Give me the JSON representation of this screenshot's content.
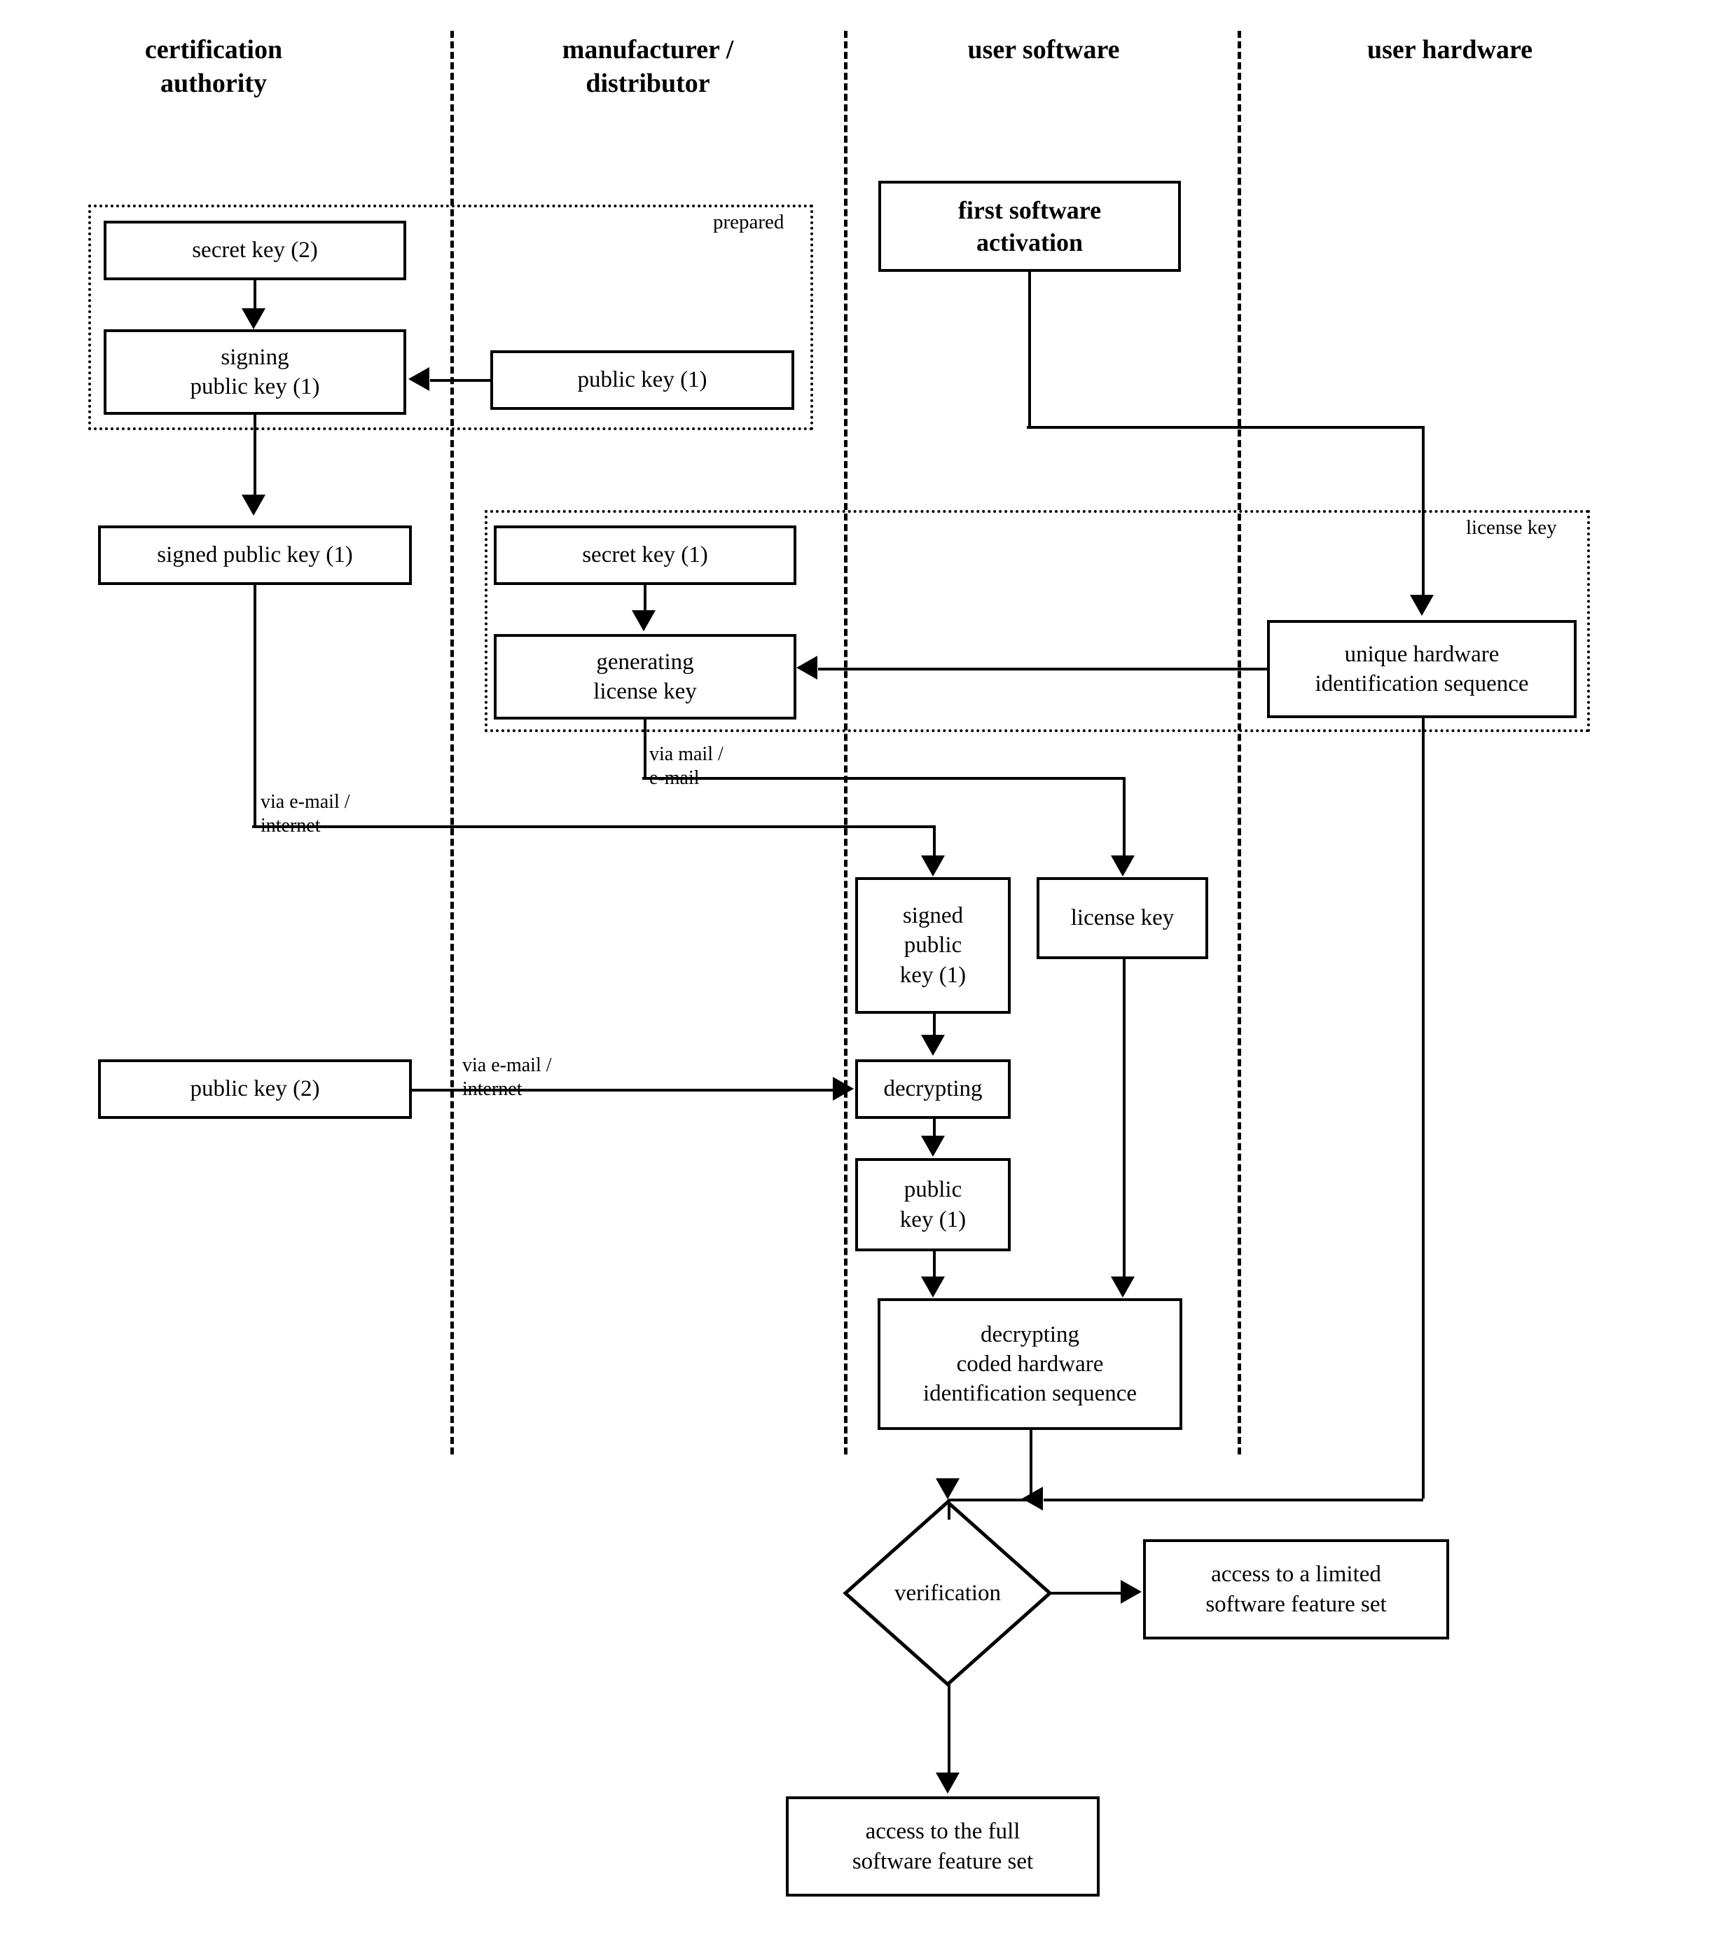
{
  "diagram": {
    "title": "software licensing and activation flowchart",
    "lanes": [
      {
        "label": "certification\nauthority"
      },
      {
        "label": "manufacturer /\ndistributor"
      },
      {
        "label": "user software"
      },
      {
        "label": "user hardware"
      }
    ],
    "groups": [
      {
        "label": "prepared"
      },
      {
        "label": "license key"
      }
    ],
    "nodes": [
      {
        "id": "secret-key-2",
        "label": "secret key (2)"
      },
      {
        "id": "signing-public-key-1",
        "label": "signing\npublic key (1)"
      },
      {
        "id": "public-key-1-mfr",
        "label": "public key (1)"
      },
      {
        "id": "first-software-activation",
        "label": "first software\nactivation"
      },
      {
        "id": "signed-public-key-1-ca",
        "label": "signed public key (1)"
      },
      {
        "id": "secret-key-1",
        "label": "secret key (1)"
      },
      {
        "id": "generating-license-key",
        "label": "generating\nlicense key"
      },
      {
        "id": "unique-hardware-id-sequence",
        "label": "unique hardware\nidentification sequence"
      },
      {
        "id": "signed-public-key-1-user",
        "label": "signed\npublic\nkey (1)"
      },
      {
        "id": "license-key",
        "label": "license key"
      },
      {
        "id": "public-key-2",
        "label": "public key (2)"
      },
      {
        "id": "decrypting",
        "label": "decrypting"
      },
      {
        "id": "public-key-1-user",
        "label": "public\nkey (1)"
      },
      {
        "id": "decrypting-coded-hardware",
        "label": "decrypting\ncoded hardware\nidentification sequence"
      },
      {
        "id": "verification",
        "label": "verification"
      },
      {
        "id": "access-limited",
        "label": "access to a limited\nsoftware feature set"
      },
      {
        "id": "access-full",
        "label": "access to the full\nsoftware feature set"
      }
    ],
    "edge_labels": [
      {
        "id": "via-mail-email",
        "label": "via mail /\ne-mail"
      },
      {
        "id": "via-email-internet-ca",
        "label": "via e-mail /\ninternet"
      },
      {
        "id": "via-email-internet-pk2",
        "label": "via e-mail /\ninternet"
      }
    ],
    "colors": {
      "stroke": "#000000",
      "background": "#ffffff"
    }
  }
}
